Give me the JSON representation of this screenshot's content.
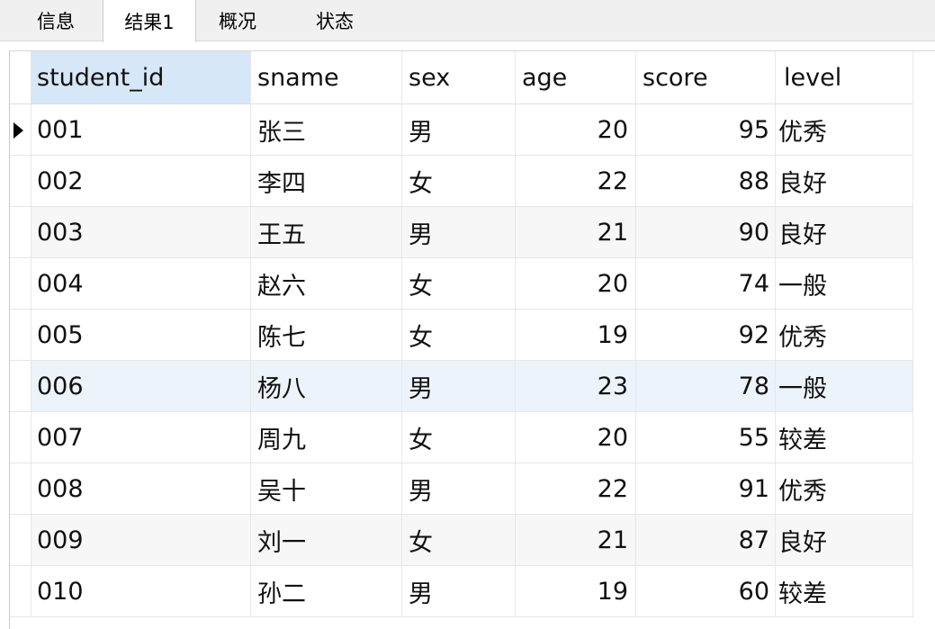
{
  "tabs": [
    {
      "label": "信息",
      "active": false
    },
    {
      "label": "结果1",
      "active": true
    },
    {
      "label": "概况",
      "active": false
    },
    {
      "label": "状态",
      "active": false
    }
  ],
  "grid": {
    "columns": [
      "student_id",
      "sname",
      "sex",
      "age",
      "score",
      "level"
    ],
    "rows": [
      [
        "001",
        "张三",
        "男",
        "20",
        "95",
        "优秀"
      ],
      [
        "002",
        "李四",
        "女",
        "22",
        "88",
        "良好"
      ],
      [
        "003",
        "王五",
        "男",
        "21",
        "90",
        "良好"
      ],
      [
        "004",
        "赵六",
        "女",
        "20",
        "74",
        "一般"
      ],
      [
        "005",
        "陈七",
        "女",
        "19",
        "92",
        "优秀"
      ],
      [
        "006",
        "杨八",
        "男",
        "23",
        "78",
        "一般"
      ],
      [
        "007",
        "周九",
        "女",
        "20",
        "55",
        "较差"
      ],
      [
        "008",
        "吴十",
        "男",
        "22",
        "91",
        "优秀"
      ],
      [
        "009",
        "刘一",
        "女",
        "21",
        "87",
        "良好"
      ],
      [
        "010",
        "孙二",
        "男",
        "19",
        "60",
        "较差"
      ]
    ]
  },
  "colors": {
    "header_selected": "#d6e7f7",
    "row_hover": "#edf3fa",
    "row_alt": "#f7f7f7"
  }
}
